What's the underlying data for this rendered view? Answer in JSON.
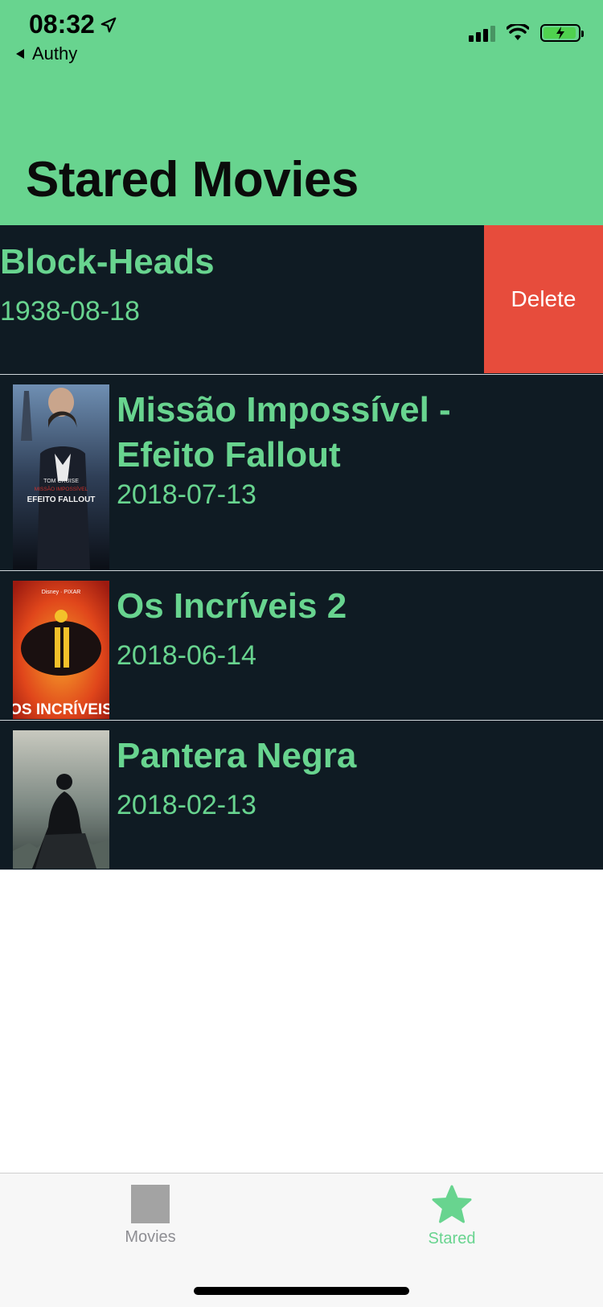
{
  "status_bar": {
    "time": "08:32",
    "back_app": "Authy",
    "location_icon": "location-arrow-icon",
    "signal_icon": "cellular-signal-icon",
    "wifi_icon": "wifi-icon",
    "battery_icon": "battery-charging-icon"
  },
  "header": {
    "title": "Stared Movies",
    "background": "#68d48f"
  },
  "movies": [
    {
      "title": "Block-Heads",
      "date": "1938-08-18",
      "poster": "none",
      "swiped": true
    },
    {
      "title": "Missão Impossível - Efeito Fallout",
      "date": "2018-07-13",
      "poster": "mission-impossible-poster"
    },
    {
      "title": "Os Incríveis 2",
      "date": "2018-06-14",
      "poster": "incredibles-2-poster"
    },
    {
      "title": "Pantera Negra",
      "date": "2018-02-13",
      "poster": "black-panther-poster"
    }
  ],
  "row_action": {
    "delete_label": "Delete",
    "color": "#e74c3c"
  },
  "list": {
    "background": "#0f1b23",
    "accent": "#68d48f"
  },
  "tabbar": {
    "items": [
      {
        "label": "Movies",
        "icon": "movies-placeholder-icon",
        "selected": false
      },
      {
        "label": "Stared",
        "icon": "star-icon",
        "selected": true
      }
    ]
  }
}
